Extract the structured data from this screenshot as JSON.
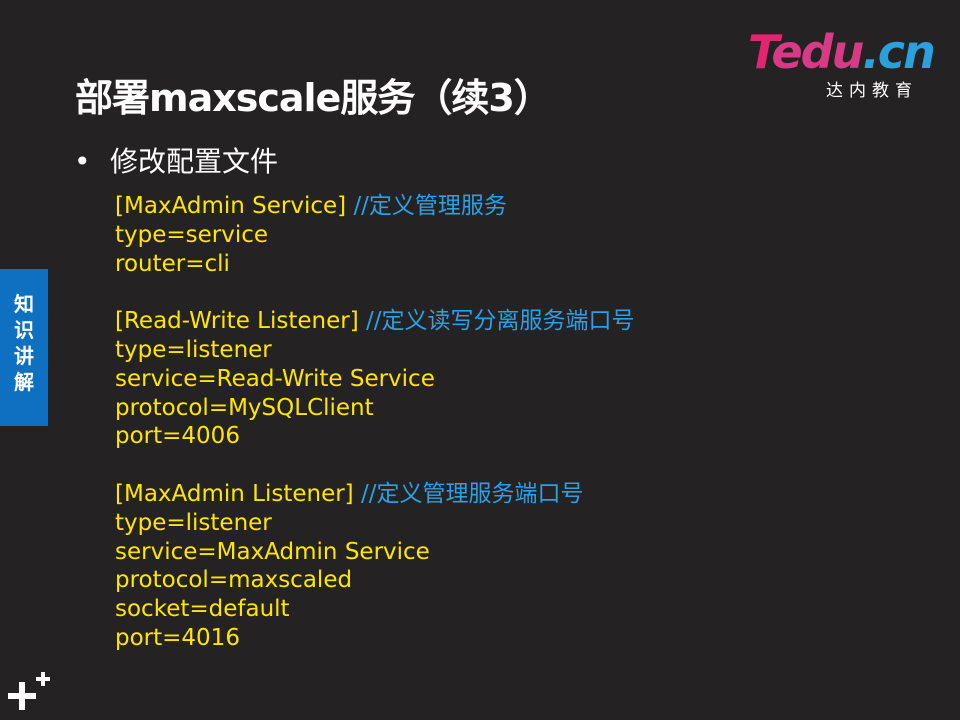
{
  "logo": {
    "brand_t": "T",
    "brand_edu": "edu",
    "brand_cn": ".cn",
    "subtitle": "达内教育"
  },
  "title": "部署maxscale服务（续3）",
  "bullet": {
    "marker": "•",
    "text": "修改配置文件"
  },
  "config_lines": [
    {
      "code": "[MaxAdmin Service]   ",
      "comment": "//定义管理服务"
    },
    {
      "code": "type=service",
      "comment": ""
    },
    {
      "code": "router=cli",
      "comment": ""
    },
    {
      "code": "",
      "comment": ""
    },
    {
      "code": "[Read-Write Listener]   ",
      "comment": "//定义读写分离服务端口号"
    },
    {
      "code": "type=listener",
      "comment": ""
    },
    {
      "code": "service=Read-Write Service",
      "comment": ""
    },
    {
      "code": "protocol=MySQLClient",
      "comment": ""
    },
    {
      "code": "port=4006",
      "comment": ""
    },
    {
      "code": "",
      "comment": ""
    },
    {
      "code": "[MaxAdmin Listener]   ",
      "comment": "//定义管理服务端口号"
    },
    {
      "code": "type=listener",
      "comment": ""
    },
    {
      "code": "service=MaxAdmin Service",
      "comment": ""
    },
    {
      "code": "protocol=maxscaled",
      "comment": ""
    },
    {
      "code": "socket=default",
      "comment": ""
    },
    {
      "code": "port=4016",
      "comment": ""
    }
  ],
  "side_tab": {
    "label_chars": [
      "知",
      "识",
      "讲",
      "解"
    ]
  },
  "icons": {
    "corner": "plus-plus-icon"
  },
  "colors": {
    "background": "#252223",
    "code_text": "#ffe600",
    "comment_text": "#2aa0e6",
    "side_tab": "#0f6fc0"
  }
}
